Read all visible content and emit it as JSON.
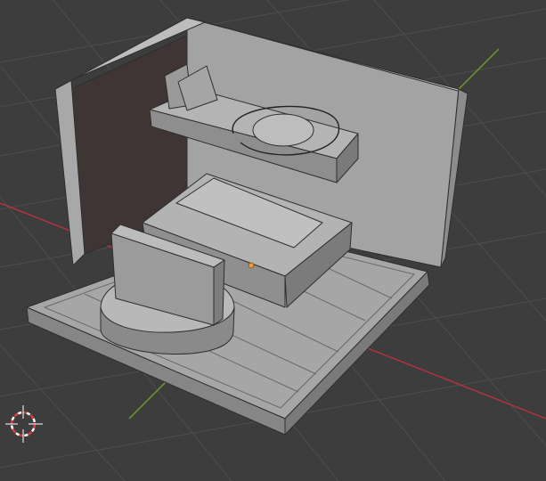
{
  "viewport": {
    "background": "#3d3d3d",
    "grid_color": "#505050",
    "x_axis_color": "#b0343f",
    "y_axis_color": "#6c9a2a",
    "model_color_light": "#a9a9a9",
    "model_color_mid": "#8e8e8e",
    "model_color_dark": "#6f6f6f",
    "model_edge": "#2a2a2a",
    "origin_dot_color": "#e6a03a",
    "cursor_color_red": "#d64040",
    "cursor_icon": "3d-cursor-icon"
  }
}
